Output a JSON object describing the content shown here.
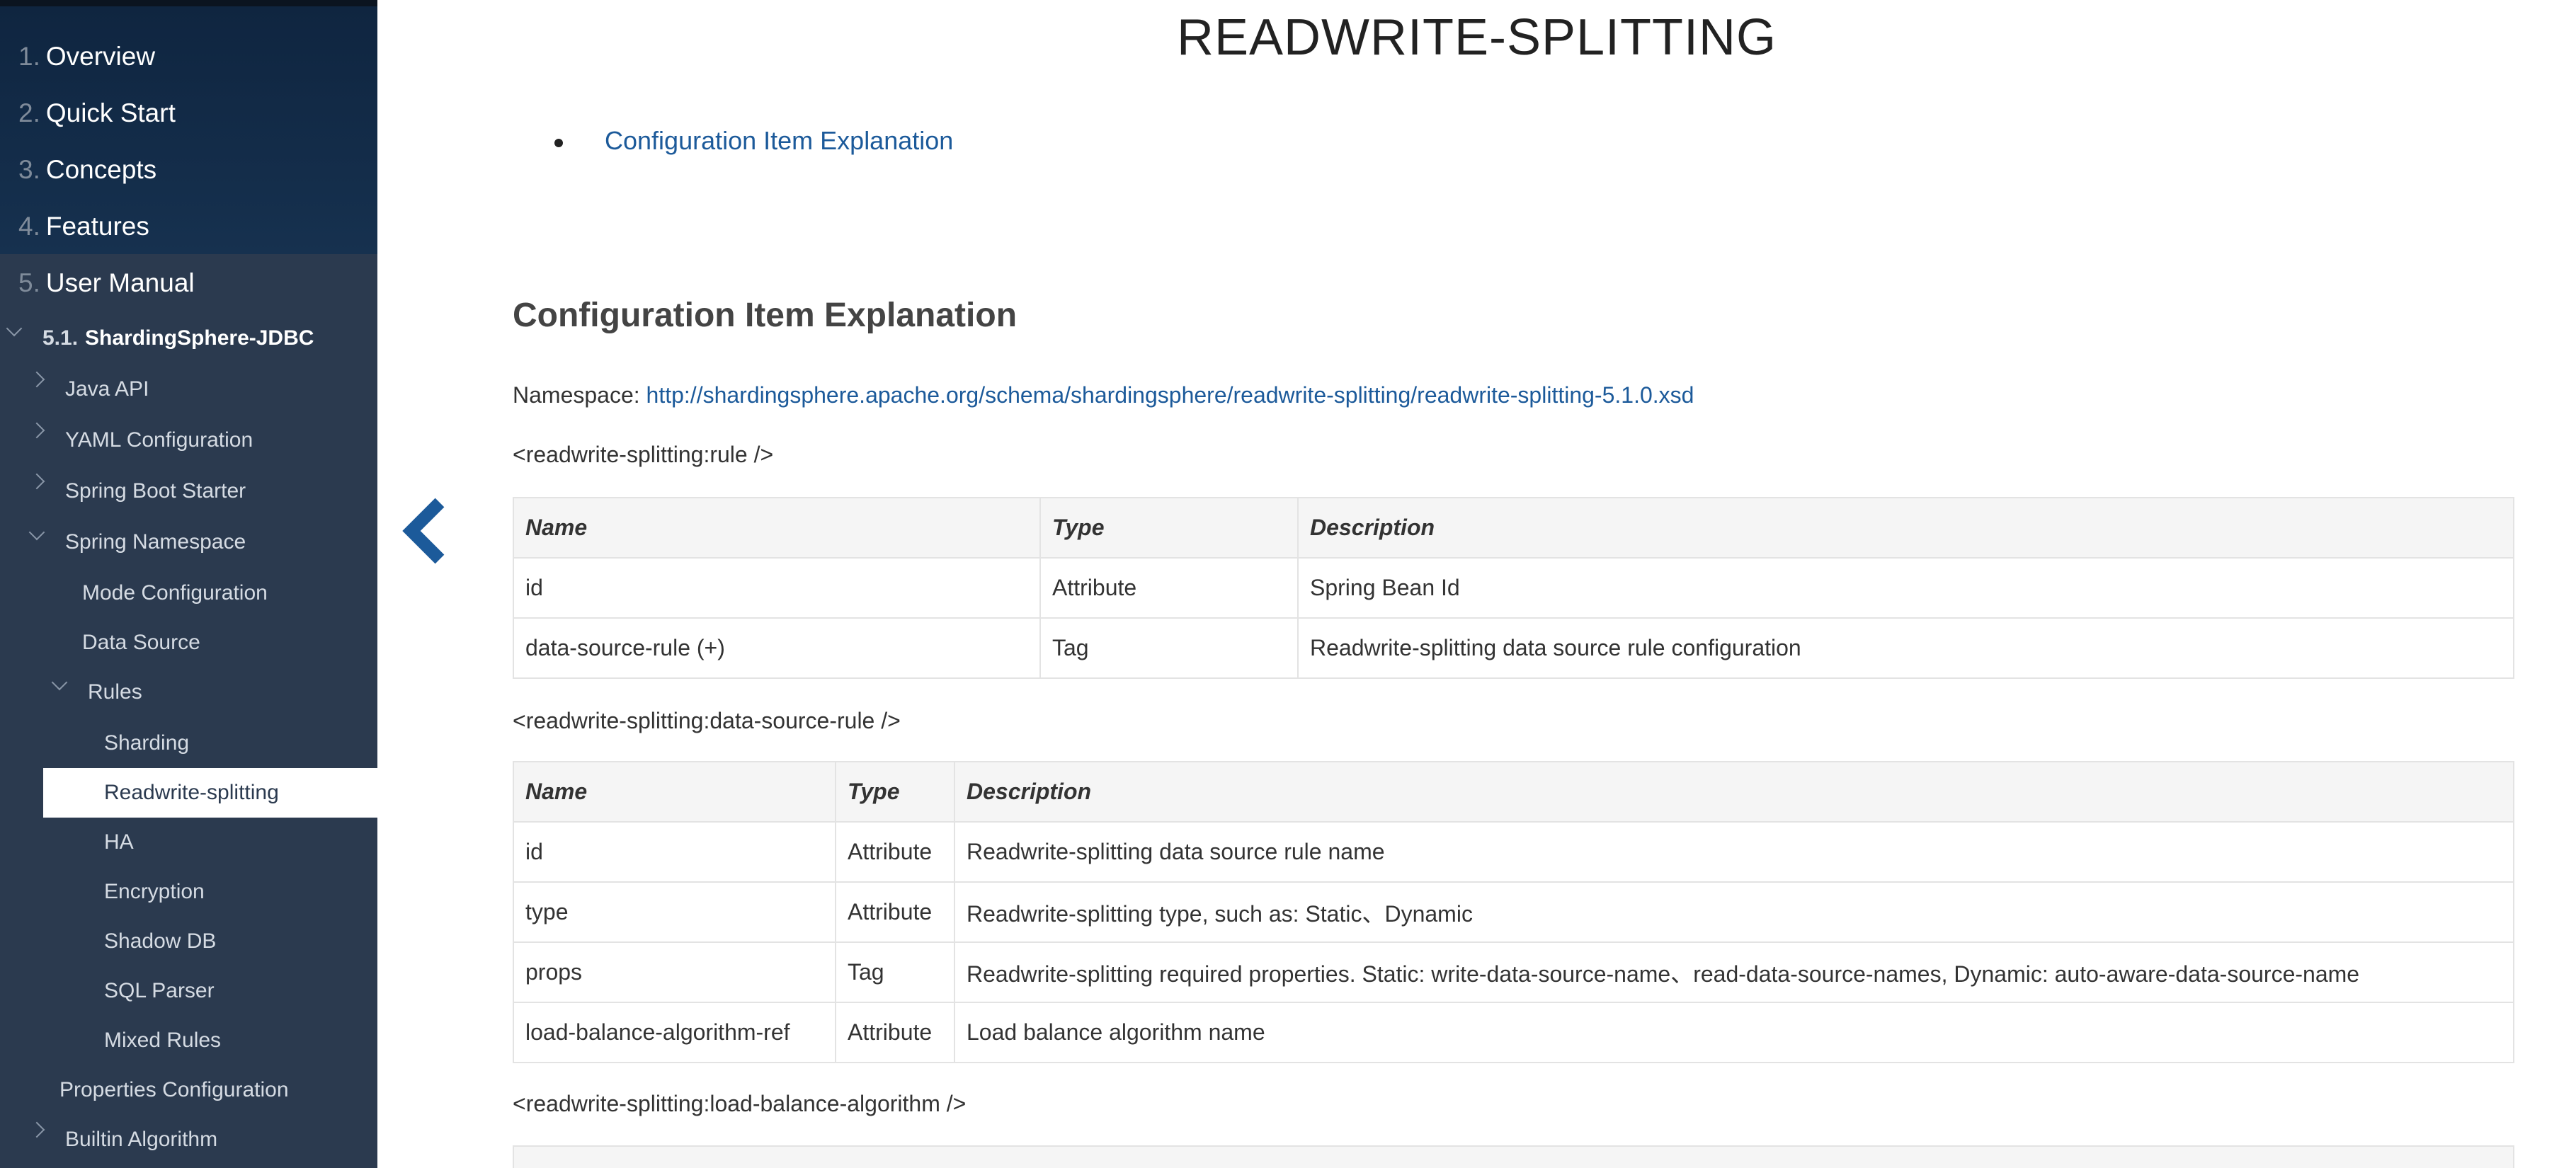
{
  "sidebar": {
    "chapters": [
      {
        "num": "1.",
        "label": "Overview"
      },
      {
        "num": "2.",
        "label": "Quick Start"
      },
      {
        "num": "3.",
        "label": "Concepts"
      },
      {
        "num": "4.",
        "label": "Features"
      },
      {
        "num": "5.",
        "label": "User Manual"
      }
    ],
    "section": {
      "num": "5.1.",
      "label": "ShardingSphere-JDBC"
    },
    "items": [
      {
        "label": "Java API"
      },
      {
        "label": "YAML Configuration"
      },
      {
        "label": "Spring Boot Starter"
      },
      {
        "label": "Spring Namespace"
      },
      {
        "label": "Mode Configuration"
      },
      {
        "label": "Data Source"
      },
      {
        "label": "Rules"
      },
      {
        "label": "Sharding"
      },
      {
        "label": "Readwrite-splitting"
      },
      {
        "label": "HA"
      },
      {
        "label": "Encryption"
      },
      {
        "label": "Shadow DB"
      },
      {
        "label": "SQL Parser"
      },
      {
        "label": "Mixed Rules"
      },
      {
        "label": "Properties Configuration"
      },
      {
        "label": "Builtin Algorithm"
      }
    ],
    "active_item": "Readwrite-splitting"
  },
  "main": {
    "title": "READWRITE-SPLITTING",
    "toc": [
      {
        "label": "Configuration Item Explanation"
      }
    ],
    "section_heading": "Configuration Item Explanation",
    "namespace_label": "Namespace:",
    "namespace_url": "http://shardingsphere.apache.org/schema/shardingsphere/readwrite-splitting/readwrite-splitting-5.1.0.xsd",
    "rule_tag": "<readwrite-splitting:rule />",
    "data_source_rule_tag": "<readwrite-splitting:data-source-rule />",
    "load_balance_tag": "<readwrite-splitting:load-balance-algorithm />",
    "headers": {
      "name": "Name",
      "type": "Type",
      "description": "Description"
    },
    "rule_table": [
      {
        "name": "id",
        "type": "Attribute",
        "description": "Spring Bean Id"
      },
      {
        "name": "data-source-rule (+)",
        "type": "Tag",
        "description": "Readwrite-splitting data source rule configuration"
      }
    ],
    "data_source_rule_table": [
      {
        "name": "id",
        "type": "Attribute",
        "description": "Readwrite-splitting data source rule name"
      },
      {
        "name": "type",
        "type": "Attribute",
        "description": "Readwrite-splitting type, such as: Static、Dynamic"
      },
      {
        "name": "props",
        "type": "Tag",
        "description": "Readwrite-splitting required properties. Static: write-data-source-name、read-data-source-names, Dynamic: auto-aware-data-source-name"
      },
      {
        "name": "load-balance-algorithm-ref",
        "type": "Attribute",
        "description": "Load balance algorithm name"
      }
    ]
  }
}
